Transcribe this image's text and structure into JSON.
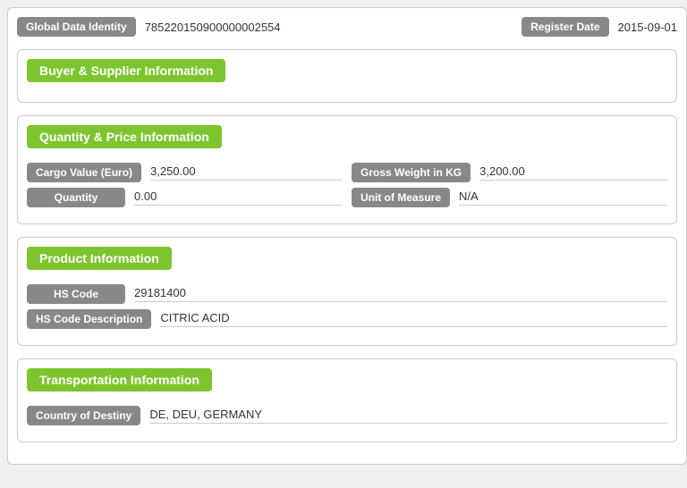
{
  "header": {
    "global_data_identity_label": "Global Data Identity",
    "global_data_identity_value": "785220150900000002554",
    "register_date_label": "Register Date",
    "register_date_value": "2015-09-01"
  },
  "sections": [
    {
      "id": "buyer-supplier",
      "title": "Buyer & Supplier Information",
      "fields": []
    },
    {
      "id": "quantity-price",
      "title": "Quantity & Price Information",
      "double_fields": [
        {
          "left_label": "Cargo Value (Euro)",
          "left_value": "3,250.00",
          "right_label": "Gross Weight in KG",
          "right_value": "3,200.00"
        },
        {
          "left_label": "Quantity",
          "left_value": "0.00",
          "right_label": "Unit of Measure",
          "right_value": "N/A"
        }
      ]
    },
    {
      "id": "product",
      "title": "Product Information",
      "fields": [
        {
          "label": "HS Code",
          "value": "29181400"
        },
        {
          "label": "HS Code Description",
          "value": "CITRIC ACID"
        }
      ]
    },
    {
      "id": "transportation",
      "title": "Transportation Information",
      "fields": [
        {
          "label": "Country of Destiny",
          "value": "DE, DEU, GERMANY"
        }
      ]
    }
  ]
}
